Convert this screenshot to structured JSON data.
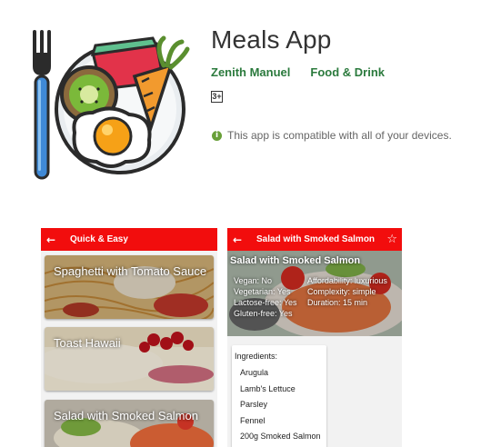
{
  "app": {
    "title": "Meals App",
    "developer": "Zenith Manuel",
    "category": "Food & Drink",
    "content_rating": "3+",
    "compatibility": "This app is compatible with all of your devices.",
    "icon": "meals-app-icon",
    "accent_color": "#2b7a3d"
  },
  "screenshot1": {
    "appbar_title": "Quick & Easy",
    "back_icon": "arrow-left-icon",
    "cards": [
      {
        "label": "Spaghetti with Tomato Sauce"
      },
      {
        "label": "Toast Hawaii"
      },
      {
        "label": "Salad with Smoked Salmon"
      }
    ]
  },
  "screenshot2": {
    "appbar_title": "Salad with Smoked Salmon",
    "favorite_icon": "star-icon",
    "hero_title": "Salad with Smoked Salmon",
    "facts_left": [
      "Vegan: No",
      "Vegetarian: Yes",
      "Lactose-free: Yes",
      "Gluten-free: Yes"
    ],
    "facts_right": [
      "Affordability: luxurious",
      "Complexity: simple",
      "Duration: 15 min"
    ],
    "ingredients_heading": "Ingredients:",
    "ingredients": [
      "Arugula",
      "Lamb's Lettuce",
      "Parsley",
      "Fennel",
      "200g Smoked Salmon"
    ]
  },
  "brand_color": "#f20d0d"
}
